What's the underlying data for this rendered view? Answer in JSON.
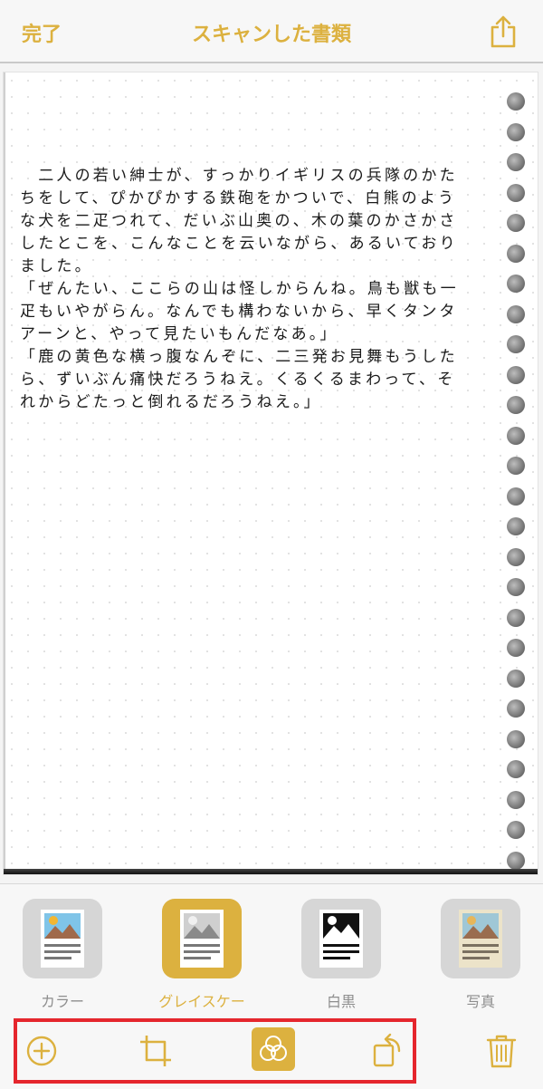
{
  "colors": {
    "accent": "#dcb13f",
    "highlight": "#e5262d"
  },
  "nav": {
    "done_label": "完了",
    "title": "スキャンした書類",
    "share_icon": "share-icon"
  },
  "document": {
    "lines": [
      "　二人の若い紳士が、すっかりイギリスの兵隊のかた",
      "ちをして、ぴかぴかする鉄砲をかついで、白熊のよう",
      "な犬を二疋つれて、だいぶ山奥の、木の葉のかさかさ",
      "したとこを、こんなことを云いながら、あるいており",
      "ました。",
      "「ぜんたい、ここらの山は怪しからんね。鳥も獣も一",
      "疋もいやがらん。なんでも構わないから、早くタンタ",
      "アーンと、やって見たいもんだなあ。」",
      "「鹿の黄色な横っ腹なんぞに、二三発お見舞もうした",
      "ら、ずいぶん痛快だろうねえ。くるくるまわって、そ",
      "れからどたっと倒れるだろうねえ。」"
    ]
  },
  "filters": {
    "selected": "grayscale",
    "items": [
      {
        "id": "color",
        "label": "カラー"
      },
      {
        "id": "grayscale",
        "label": "グレイスケール"
      },
      {
        "id": "bw",
        "label": "白黒"
      },
      {
        "id": "photo",
        "label": "写真"
      }
    ]
  },
  "toolbar": {
    "icons": [
      "add-circle-icon",
      "crop-icon",
      "filters-icon",
      "rotate-icon",
      "trash-icon"
    ]
  }
}
